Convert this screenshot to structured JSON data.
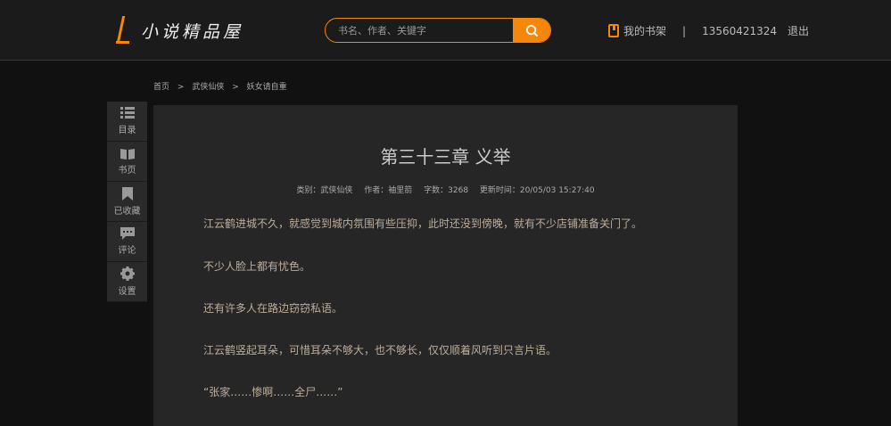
{
  "header": {
    "logo": "小说精品屋",
    "search_placeholder": "书名、作者、关键字",
    "shelf": "我的书架",
    "divider": "|",
    "phone": "13560421324",
    "logout": "退出"
  },
  "breadcrumb": [
    "首页",
    ">",
    "武侠仙侠",
    ">",
    "妖女请自重"
  ],
  "sidebar": [
    {
      "label": "目录",
      "icon": "list-icon"
    },
    {
      "label": "书页",
      "icon": "book-icon"
    },
    {
      "label": "已收藏",
      "icon": "bookmark-icon"
    },
    {
      "label": "评论",
      "icon": "comment-icon"
    },
    {
      "label": "设置",
      "icon": "gear-icon"
    }
  ],
  "chapter": {
    "title": "第三十三章 义举",
    "category": "类别：武侠仙侠",
    "author": "作者：袖里箭",
    "words": "字数：3268",
    "updated": "更新时间：20/05/03 15:27:40",
    "paragraphs": [
      "江云鹤进城不久，就感觉到城内氛围有些压抑，此时还没到傍晚，就有不少店铺准备关门了。",
      "不少人脸上都有忧色。",
      "还有许多人在路边窃窃私语。",
      "江云鹤竖起耳朵，可惜耳朵不够大，也不够长，仅仅顺着风听到只言片语。",
      "“张家……惨啊……全尸……”"
    ]
  },
  "colors": {
    "accent": "#f7870b"
  }
}
